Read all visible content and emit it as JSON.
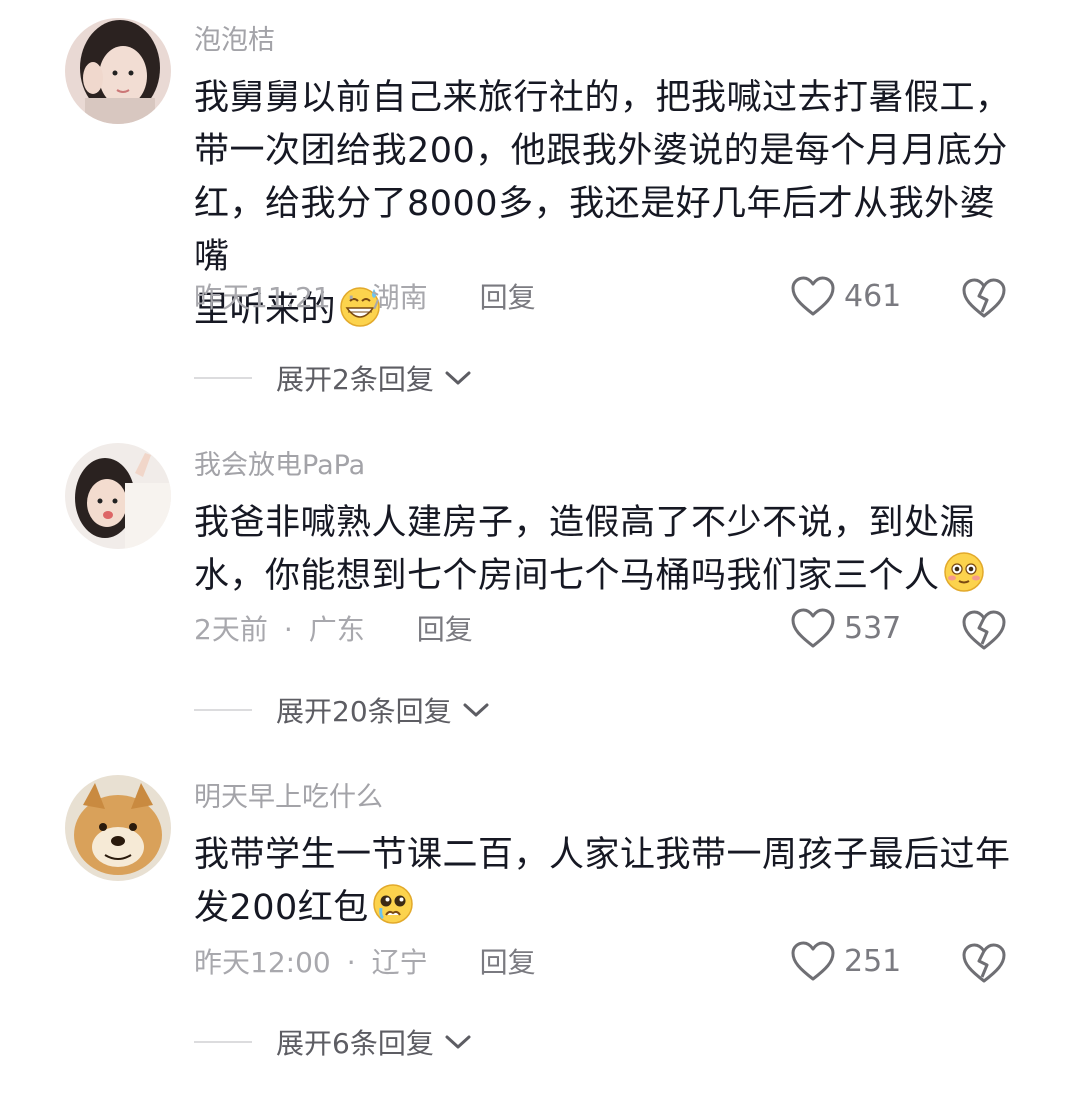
{
  "comments": [
    {
      "username": "泡泡桔",
      "text_lines": [
        "我舅舅以前自己来旅行社的，把我喊过去打暑假工，",
        "带一次团给我200，他跟我外婆说的是每个月月底分",
        "红，给我分了8000多，我还是好几年后才从我外婆嘴",
        "里听来的"
      ],
      "emoji": "grinning-sweat-emoji",
      "time": "昨天11:21",
      "location": "湖南",
      "reply_label": "回复",
      "likes": "461",
      "expand_label": "展开2条回复"
    },
    {
      "username": "我会放电PaPa",
      "text_lines": [
        "我爸非喊熟人建房子，造假高了不少不说，到处漏",
        "水，你能想到七个房间七个马桶吗我们家三个人"
      ],
      "emoji": "flushed-emoji",
      "time": "2天前",
      "location": "广东",
      "reply_label": "回复",
      "likes": "537",
      "expand_label": "展开20条回复"
    },
    {
      "username": "明天早上吃什么",
      "text_lines": [
        "我带学生一节课二百，人家让我带一周孩子最后过年",
        "发200红包"
      ],
      "emoji": "pleading-emoji",
      "time": "昨天12:00",
      "location": "辽宁",
      "reply_label": "回复",
      "likes": "251",
      "expand_label": "展开6条回复"
    }
  ],
  "separator": "·",
  "icons": {
    "like": "heart-outline-icon",
    "dislike": "broken-heart-icon",
    "expand": "chevron-down-icon"
  },
  "colors": {
    "username": "#a3a3a8",
    "text": "#161823",
    "meta": "#a8a8ad"
  }
}
